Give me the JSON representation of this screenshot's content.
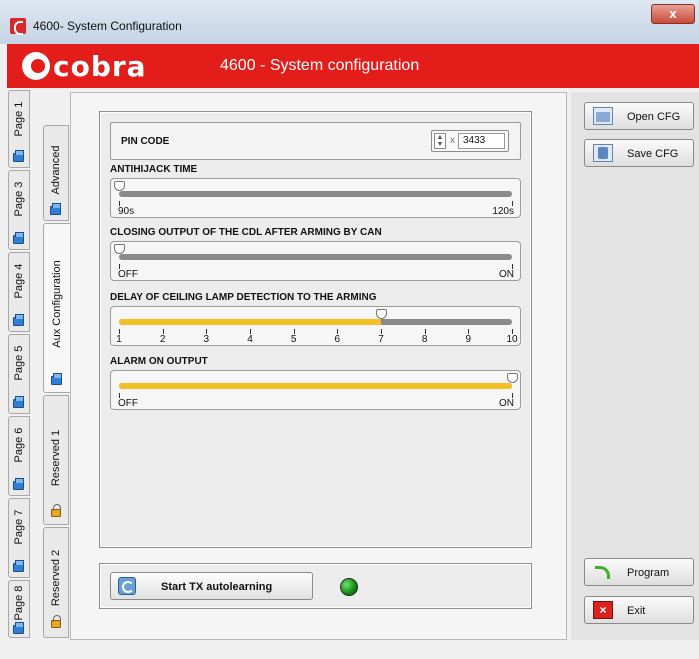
{
  "window": {
    "title": "4600- System Configuration",
    "close_label": "x"
  },
  "brand": {
    "logo_text": "cobra",
    "header_title": "4600 - System configuration",
    "color": "#e31d1a"
  },
  "outer_tabs": [
    {
      "label": "Page 1"
    },
    {
      "label": "Page 3"
    },
    {
      "label": "Page 4"
    },
    {
      "label": "Page 5"
    },
    {
      "label": "Page 6"
    },
    {
      "label": "Page 7"
    },
    {
      "label": "Page 8"
    }
  ],
  "inner_tabs": [
    {
      "label": "Advanced"
    },
    {
      "label": "Aux Configuration"
    },
    {
      "label": "Reserved 1"
    },
    {
      "label": "Reserved 2"
    }
  ],
  "pin": {
    "label": "PIN CODE",
    "prefix": "x",
    "value": "3433"
  },
  "sliders": [
    {
      "title": "ANTIHIJACK TIME",
      "value_fraction": 0.0,
      "ticks": [
        "90s",
        "120s"
      ]
    },
    {
      "title": "CLOSING OUTPUT OF THE CDL AFTER ARMING BY CAN",
      "value_fraction": 0.0,
      "ticks": [
        "OFF",
        "ON"
      ]
    },
    {
      "title": "DELAY OF CEILING LAMP DETECTION TO THE ARMING",
      "value": 7,
      "value_fraction": 0.6667,
      "ticks": [
        "1",
        "2",
        "3",
        "4",
        "5",
        "6",
        "7",
        "8",
        "9",
        "10"
      ]
    },
    {
      "title": "ALARM ON OUTPUT",
      "value_fraction": 1.0,
      "ticks": [
        "OFF",
        "ON"
      ]
    }
  ],
  "tx": {
    "button_label": "Start TX autolearning",
    "led_color": "#119911"
  },
  "actions": {
    "open": "Open CFG",
    "save": "Save CFG",
    "program": "Program",
    "exit": "Exit"
  }
}
